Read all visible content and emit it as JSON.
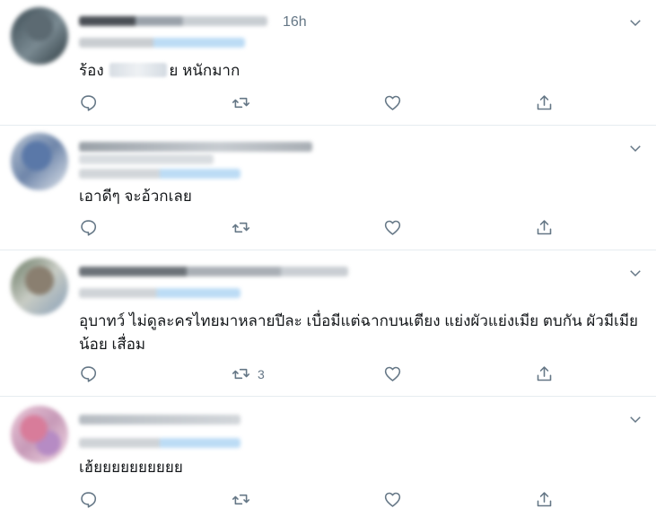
{
  "colors": {
    "icon": "#657786",
    "text": "#14171a",
    "divider": "#e6ecf0",
    "link_blur": "#bcdcf5"
  },
  "tweets": [
    {
      "time": "16h",
      "text_before": "ร้อง",
      "text_after": "ย หนักมาก",
      "reply_count": "",
      "retweet_count": "",
      "like_count": ""
    },
    {
      "time": "",
      "text": "เอาดีๆ จะอ้วกเลย",
      "reply_count": "",
      "retweet_count": "",
      "like_count": ""
    },
    {
      "time": "",
      "text": "อุบาทว์ ไม่ดูละครไทยมาหลายปีละ เบื่อมีแต่ฉากบนเตียง แย่งผัวแย่งเมีย ตบกัน ผัวมีเมียน้อย เสื่อม",
      "reply_count": "",
      "retweet_count": "3",
      "like_count": ""
    },
    {
      "time": "",
      "text": "เฮ้ยยยยยยยยยย",
      "reply_count": "",
      "retweet_count": "",
      "like_count": ""
    }
  ],
  "icons": {
    "reply": "reply-icon",
    "retweet": "retweet-icon",
    "like": "heart-icon",
    "share": "share-icon",
    "more": "chevron-down-icon"
  }
}
